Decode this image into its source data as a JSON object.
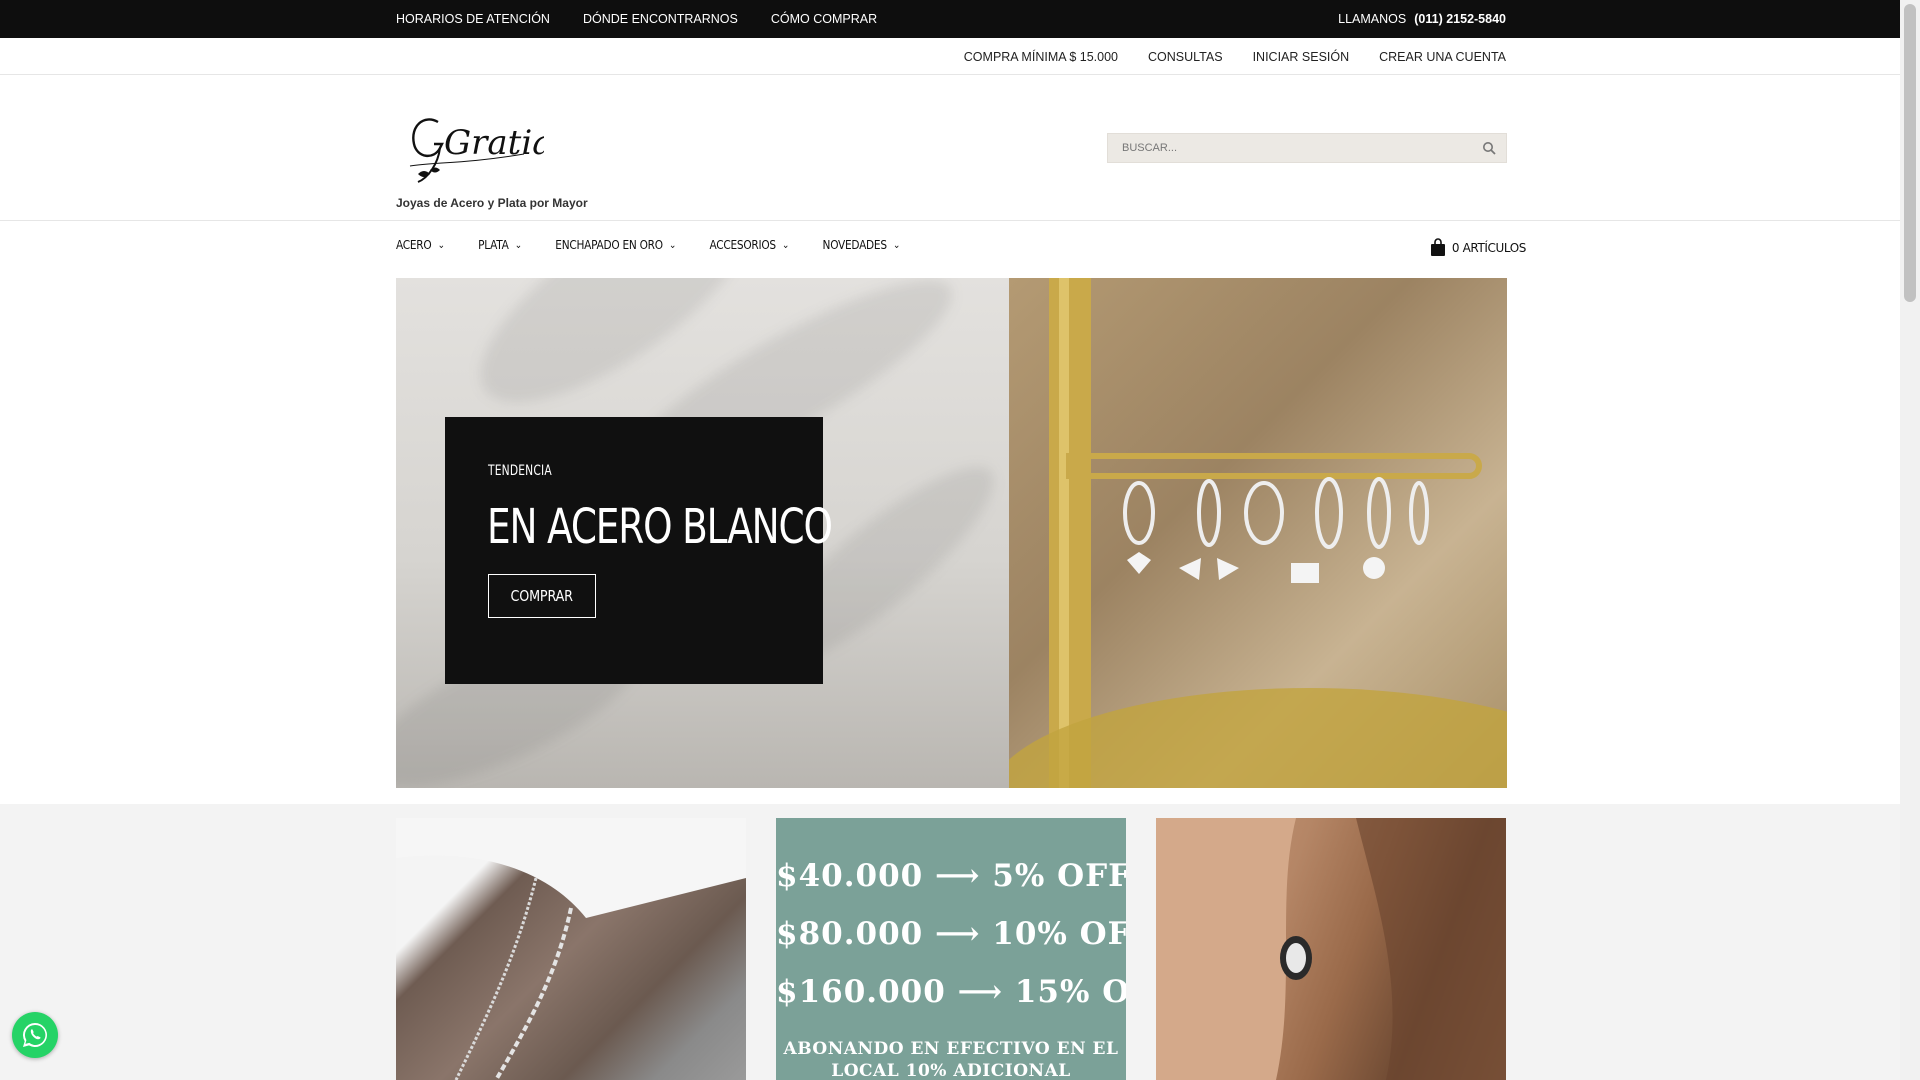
{
  "topbar": {
    "links": [
      "HORARIOS DE ATENCIÓN",
      "DÓNDE ENCONTRARNOS",
      "CÓMO COMPRAR"
    ],
    "call_label": "LLAMANOS",
    "phone": "(011) 2152-5840"
  },
  "subbar": {
    "min_purchase": "COMPRA MÍNIMA $ 15.000",
    "consultas": "CONSULTAS",
    "login": "INICIAR SESIÓN",
    "register": "CREAR UNA CUENTA"
  },
  "header": {
    "logo_text": "Gratia",
    "tagline": "Joyas de Acero y Plata por Mayor",
    "search_placeholder": "BUSCAR..."
  },
  "nav": {
    "items": [
      "ACERO",
      "PLATA",
      "ENCHAPADO EN ORO",
      "ACCESORIOS",
      "NOVEDADES"
    ],
    "cart_label": "0 ARTÍCULOS"
  },
  "hero": {
    "eyebrow": "TENDENCIA",
    "title": "EN ACERO BLANCO",
    "button": "COMPRAR"
  },
  "promo": {
    "lines": [
      {
        "amount": "$40.000",
        "discount": "5%",
        "off": "OFF"
      },
      {
        "amount": "$80.000",
        "discount": "10%",
        "off": "OFF"
      },
      {
        "amount": "$160.000",
        "discount": "15%",
        "off": "OFF"
      }
    ],
    "note": "ABONANDO EN EFECTIVO EN EL LOCAL 10% ADICIONAL"
  },
  "colors": {
    "topbar": "#0e0e0e",
    "promo_bg": "#7ba198",
    "whatsapp": "#25d366"
  }
}
